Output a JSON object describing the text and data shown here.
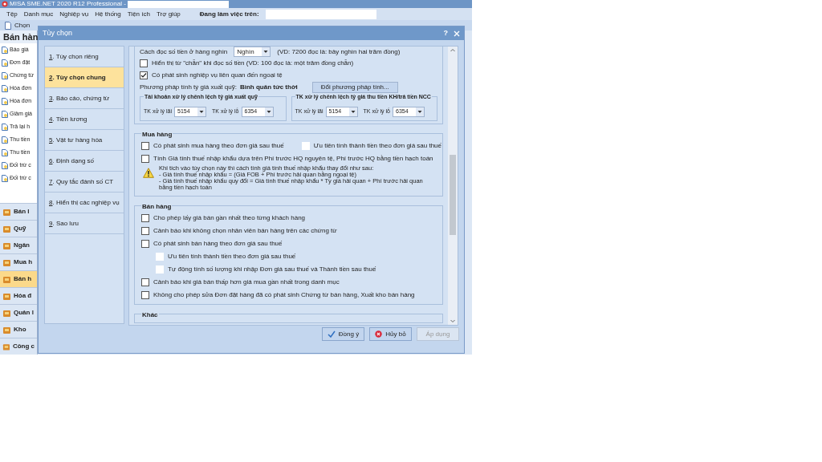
{
  "app": {
    "title": "MISA SME.NET 2020 R12 Professional -",
    "menu": [
      "Tệp",
      "Danh mục",
      "Nghiệp vụ",
      "Hệ thống",
      "Tiện ích",
      "Trợ giúp"
    ],
    "working_on_label": "Đang làm việc trên:",
    "toolbar": [
      "Chọn"
    ]
  },
  "side_panel": {
    "title": "Bán hàn",
    "items": [
      "Báo giá",
      "Đơn đặt",
      "Chứng từ",
      "Hóa đơn",
      "Hóa đơn",
      "Giảm giá",
      "Trả lại h",
      "Thu tiền",
      "Thu tiền",
      "Đối trừ c",
      "Đối trừ c"
    ],
    "modules": [
      {
        "label": "Bán l",
        "selected": false
      },
      {
        "label": "Quỹ",
        "selected": false
      },
      {
        "label": "Ngân",
        "selected": false
      },
      {
        "label": "Mua h",
        "selected": false
      },
      {
        "label": "Bán h",
        "selected": true
      },
      {
        "label": "Hóa đ",
        "selected": false
      },
      {
        "label": "Quản l",
        "selected": false
      },
      {
        "label": "Kho",
        "selected": false
      },
      {
        "label": "Công c",
        "selected": false
      }
    ]
  },
  "dialog": {
    "title": "Tùy chọn",
    "help": "?",
    "nav": [
      {
        "label": "1. Tùy chọn riêng",
        "selected": false
      },
      {
        "label": "2. Tùy chọn chung",
        "selected": true
      },
      {
        "label": "3. Báo cáo, chứng từ",
        "selected": false
      },
      {
        "label": "4. Tiền lương",
        "selected": false
      },
      {
        "label": "5. Vật tư hàng hóa",
        "selected": false
      },
      {
        "label": "6. Định dạng số",
        "selected": false
      },
      {
        "label": "7. Quy tắc đánh số CT",
        "selected": false
      },
      {
        "label": "8. Hiển thị các nghiệp vụ",
        "selected": false
      },
      {
        "label": "9. Sao lưu",
        "selected": false
      }
    ],
    "reading": {
      "label": "Cách đọc số tiền ở hàng nghìn",
      "value": "Nghìn",
      "example": "(VD: 7200 đọc là: bảy nghìn hai trăm đồng)"
    },
    "options": [
      {
        "label": "Hiển thị từ \"chẵn\" khi đọc số tiền (VD: 100 đọc là: một trăm đồng chẵn)",
        "checked": false
      },
      {
        "label": "Có phát sinh nghiệp vụ liên quan đến ngoại tệ",
        "checked": true
      }
    ],
    "rate_method": {
      "label": "Phương pháp tính tỷ giá xuất quỹ:",
      "value": "Bình quân tức thời",
      "button": "Đổi phương pháp tính..."
    },
    "account_groups": [
      {
        "title": "Tài khoản xử lý chênh lệch tỷ giá xuất quỹ",
        "fields": [
          {
            "label": "TK xử lý lãi",
            "value": "5154"
          },
          {
            "label": "TK xử lý lỗ",
            "value": "6354"
          }
        ]
      },
      {
        "title": "TK xử lý chênh lệch tỷ giá thu tiền KH/trả tiền NCC",
        "fields": [
          {
            "label": "TK xử lý lãi",
            "value": "5154"
          },
          {
            "label": "TK xử lý lỗ",
            "value": "6354"
          }
        ]
      }
    ],
    "sections": [
      {
        "title": "Mua hàng",
        "rows": [
          {
            "kind": "pair",
            "items": [
              {
                "label": "Có phát sinh mua hàng theo đơn giá sau thuế",
                "checked": false,
                "disabled": false
              },
              {
                "label": "Ưu tiên tính thành tiền theo đơn giá sau thuế",
                "checked": false,
                "disabled": true
              }
            ]
          },
          {
            "kind": "checkbox",
            "label": "Tính Giá tính thuế nhập khẩu dựa trên Phí trước HQ nguyên tệ, Phí trước HQ bằng tiền hạch toán",
            "checked": false,
            "disabled": false
          },
          {
            "kind": "note",
            "lines": [
              "Khi tích vào tùy chọn này thì cách tính giá tính thuế nhập khẩu thay đổi như sau:",
              "- Giá tính thuế nhập khẩu = (Giá FOB + Phí trước hải quan bằng ngoại tệ)",
              "- Giá tính thuế nhập khẩu quy đổi = Giá tính thuế nhập khẩu * Tỷ giá hải quan + Phí trước hải quan bằng tiền hạch toán"
            ]
          }
        ]
      },
      {
        "title": "Bán hàng",
        "rows": [
          {
            "kind": "checkbox",
            "label": "Cho phép lấy giá bán gần nhất theo từng khách hàng",
            "checked": false,
            "disabled": false
          },
          {
            "kind": "checkbox",
            "label": "Cảnh báo khi không chọn nhân viên bán hàng trên các chứng từ",
            "checked": false,
            "disabled": false
          },
          {
            "kind": "checkbox",
            "label": "Có phát sinh bán hàng theo đơn giá sau thuế",
            "checked": false,
            "disabled": false,
            "children": [
              {
                "label": "Ưu tiên tính thành tiền theo đơn giá sau thuế",
                "checked": false,
                "disabled": true
              },
              {
                "label": "Tự động tính số lượng khi nhập Đơn giá sau thuế và Thành tiền sau thuế",
                "checked": false,
                "disabled": true
              }
            ]
          },
          {
            "kind": "checkbox",
            "label": "Cảnh báo khi giá bán thấp hơn giá mua gần nhất trong danh mục",
            "checked": false,
            "disabled": false
          },
          {
            "kind": "checkbox",
            "label": "Không cho phép sửa Đơn đặt hàng đã có phát sinh Chứng từ bán hàng, Xuất kho bán hàng",
            "checked": false,
            "disabled": false
          }
        ]
      },
      {
        "title": "Khác"
      }
    ],
    "buttons": [
      {
        "label": "Đồng ý",
        "kind": "ok",
        "disabled": false
      },
      {
        "label": "Hủy bỏ",
        "kind": "cancel",
        "disabled": false
      },
      {
        "label": "Áp dụng",
        "kind": "apply",
        "disabled": true
      }
    ]
  }
}
